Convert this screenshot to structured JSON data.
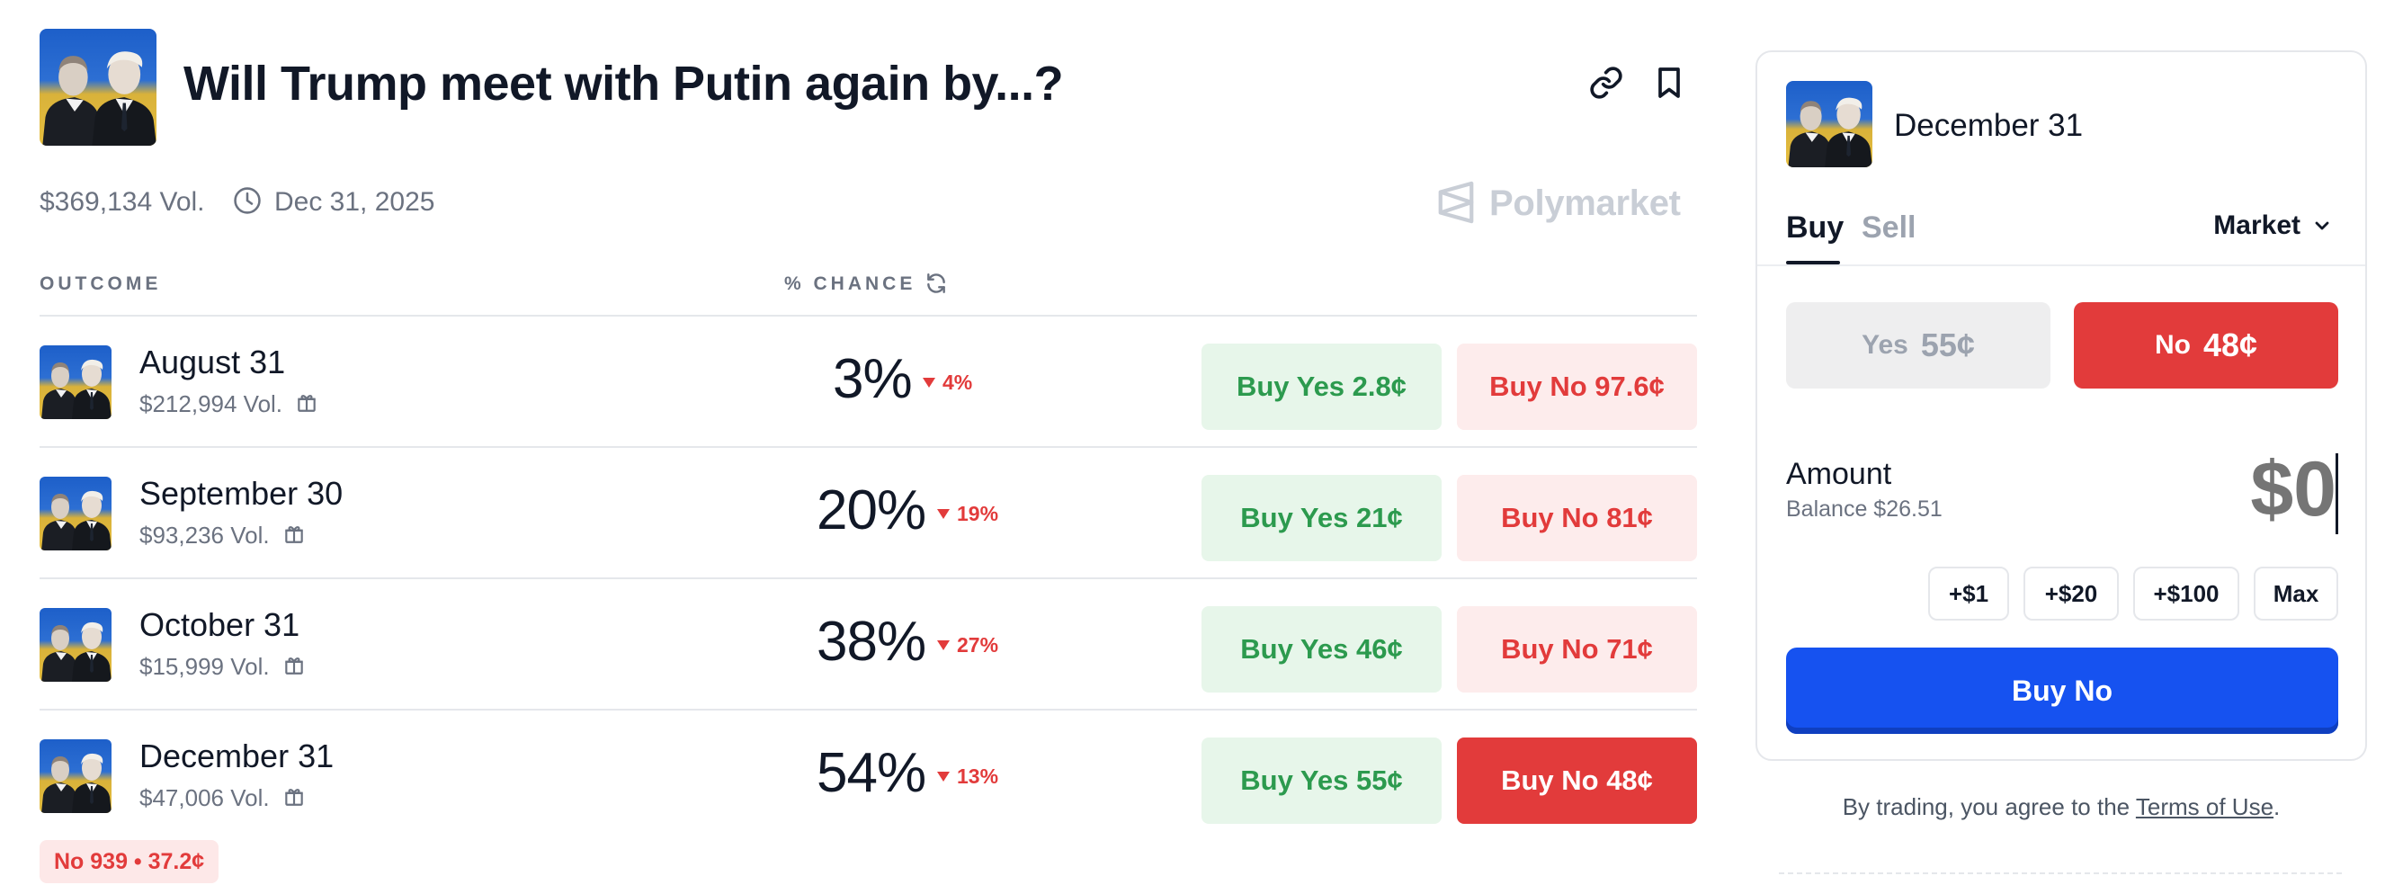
{
  "market": {
    "title": "Will Trump meet with Putin again by...?",
    "volume": "$369,134 Vol.",
    "end_date": "Dec 31, 2025",
    "brand": "Polymarket"
  },
  "table": {
    "col_outcome": "OUTCOME",
    "col_chance": "% CHANCE"
  },
  "outcomes": [
    {
      "name": "August 31",
      "volume": "$212,994 Vol.",
      "chance": "3%",
      "delta": "4%",
      "buy_yes": "Buy Yes 2.8¢",
      "buy_no": "Buy No 97.6¢",
      "delta_direction": "down",
      "selected": false
    },
    {
      "name": "September 30",
      "volume": "$93,236 Vol.",
      "chance": "20%",
      "delta": "19%",
      "buy_yes": "Buy Yes 21¢",
      "buy_no": "Buy No 81¢",
      "delta_direction": "down",
      "selected": false
    },
    {
      "name": "October 31",
      "volume": "$15,999 Vol.",
      "chance": "38%",
      "delta": "27%",
      "buy_yes": "Buy Yes 46¢",
      "buy_no": "Buy No 71¢",
      "delta_direction": "down",
      "selected": false
    },
    {
      "name": "December 31",
      "volume": "$47,006 Vol.",
      "chance": "54%",
      "delta": "13%",
      "buy_yes": "Buy Yes 55¢",
      "buy_no": "Buy No 48¢",
      "delta_direction": "down",
      "selected": true
    }
  ],
  "position_badge": "No 939 • 37.2¢",
  "trade_panel": {
    "title": "December 31",
    "tab_buy": "Buy",
    "tab_sell": "Sell",
    "order_type": "Market",
    "yes_label": "Yes",
    "yes_price": "55¢",
    "no_label": "No",
    "no_price": "48¢",
    "amount_label": "Amount",
    "balance": "Balance $26.51",
    "amount_placeholder": "$0",
    "chips": [
      "+$1",
      "+$20",
      "+$100",
      "Max"
    ],
    "submit_label": "Buy No",
    "terms_prefix": "By trading, you agree to the ",
    "terms_link": "Terms of Use",
    "terms_suffix": "."
  },
  "colors": {
    "yes_green": "#2c9a4e",
    "yes_bg": "#e7f6ea",
    "no_red": "#e23b3b",
    "no_bg": "#fdecec",
    "primary_blue": "#1652f0",
    "muted_text": "#6b7280"
  },
  "icons": {
    "header_actions": [
      "link-icon",
      "bookmark-icon"
    ],
    "meta": "clock-icon",
    "refresh": "refresh-icon",
    "row_reward": "gift-icon",
    "dropdown": "chevron-down-icon"
  }
}
